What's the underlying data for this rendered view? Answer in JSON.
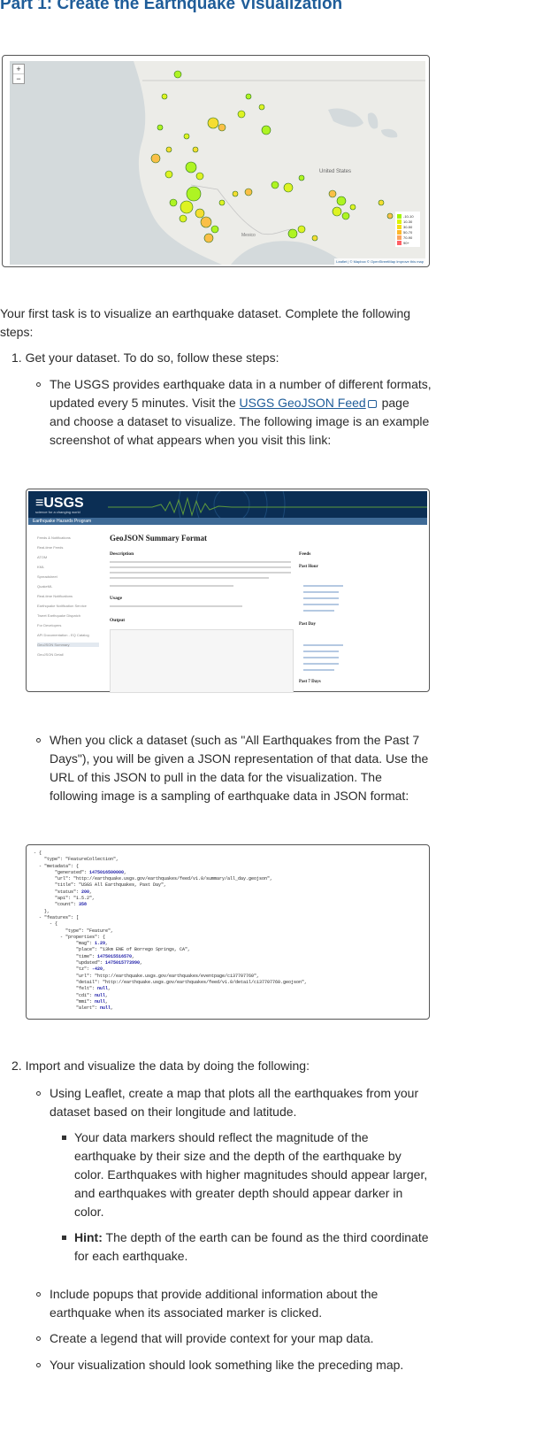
{
  "title": "Part 1: Create the Earthquake Visualization",
  "map": {
    "zoom_in": "+",
    "zoom_out": "−",
    "label_us": "United States",
    "label_mexico": "Mexico",
    "legend": [
      {
        "label": "-10-10",
        "color": "#a3f600"
      },
      {
        "label": "10-30",
        "color": "#dcf400"
      },
      {
        "label": "30-50",
        "color": "#f7db11"
      },
      {
        "label": "50-70",
        "color": "#fdb72a"
      },
      {
        "label": "70-90",
        "color": "#fca35d"
      },
      {
        "label": "90+",
        "color": "#ff5f65"
      }
    ],
    "attribution": "Leaflet | © Mapbox © OpenStreetMap Improve this map"
  },
  "intro": "Your first task is to visualize an earthquake dataset. Complete the following steps:",
  "step1": {
    "label": "1. Get your dataset. To do so, follow these steps:",
    "b1_pre": "The USGS provides earthquake data in a number of different formats, updated every 5 minutes. Visit the ",
    "b1_link": "USGS GeoJSON Feed",
    "b1_post": " page and choose a dataset to visualize. The following image is an example screenshot of what appears when you visit this link:",
    "b2": "When you click a dataset (such as \"All Earthquakes from the Past 7 Days\"), you will be given a JSON representation of that data. Use the URL of this JSON to pull in the data for the visualization. The following image is a sampling of earthquake data in JSON format:"
  },
  "usgs": {
    "logo": "≡USGS",
    "tagline": "science for a changing world",
    "subbar": "Earthquake Hazards Program",
    "nav": [
      "Feeds & Notifications",
      "Real-time Feeds",
      "ATOM",
      "KML",
      "Spreadsheet",
      "QuakeML",
      "Real-time Notifications",
      "Earthquake Notification Service",
      "Tweet Earthquake Dispatch",
      "For Developers",
      "API Documentation - EQ Catalog",
      "GeoJSON Summary",
      "GeoJSON Detail"
    ],
    "heading": "GeoJSON Summary Format",
    "description": "Description",
    "usage": "Usage",
    "output": "Output",
    "feeds": "Feeds",
    "past_hour": "Past Hour",
    "past_day": "Past Day",
    "past_7_days": "Past 7 Days"
  },
  "json_lines": [
    "- {",
    "    \"type\": \"FeatureCollection\",",
    "  - \"metadata\": {",
    "        \"generated\": 1475016500000,",
    "        \"url\": \"http://earthquake.usgs.gov/earthquakes/feed/v1.0/summary/all_day.geojson\",",
    "        \"title\": \"USGS All Earthquakes, Past Day\",",
    "        \"status\": 200,",
    "        \"api\": \"1.5.2\",",
    "        \"count\": 358",
    "    },",
    "  - \"features\": [",
    "      - {",
    "            \"type\": \"Feature\",",
    "          - \"properties\": {",
    "                \"mag\": 1.29,",
    "                \"place\": \"13km ENE of Borrego Springs, CA\",",
    "                \"time\": 1475015516570,",
    "                \"updated\": 1475015773990,",
    "                \"tz\": -420,",
    "                \"url\": \"http://earthquake.usgs.gov/earthquakes/eventpage/ci37707760\",",
    "                \"detail\": \"http://earthquake.usgs.gov/earthquakes/feed/v1.0/detail/ci37707760.geojson\",",
    "                \"felt\": null,",
    "                \"cdi\": null,",
    "                \"mmi\": null,",
    "                \"alert\": null,"
  ],
  "step2": {
    "label": "2. Import and visualize the data by doing the following:",
    "b1": "Using Leaflet, create a map that plots all the earthquakes from your dataset based on their longitude and latitude.",
    "sub1": "Your data markers should reflect the magnitude of the earthquake by their size and the depth of the earthquake by color. Earthquakes with higher magnitudes should appear larger, and earthquakes with greater depth should appear darker in color.",
    "hint_label": "Hint:",
    "hint_text": " The depth of the earth can be found as the third coordinate for each earthquake.",
    "b2": "Include popups that provide additional information about the earthquake when its associated marker is clicked.",
    "b3": "Create a legend that will provide context for your map data.",
    "b4": "Your visualization should look something like the preceding map."
  }
}
